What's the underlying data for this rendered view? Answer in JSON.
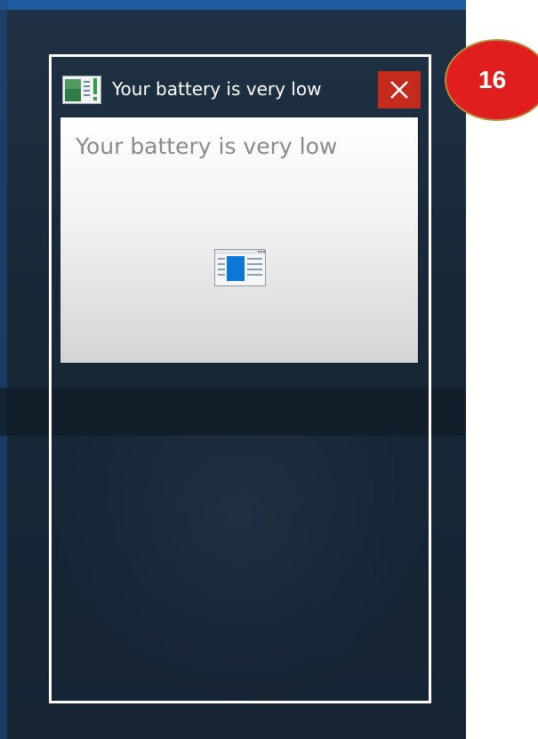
{
  "window": {
    "title": "Your battery is very low",
    "preview_title": "Your battery is very low",
    "app_icon": "battery-app-icon",
    "close_icon": "close-icon",
    "close_color": "#c42b1c"
  },
  "annotation": {
    "label": "16",
    "color": "#e11e1e"
  },
  "colors": {
    "desktop": "#18293a",
    "highlight_border": "#ffffff"
  }
}
